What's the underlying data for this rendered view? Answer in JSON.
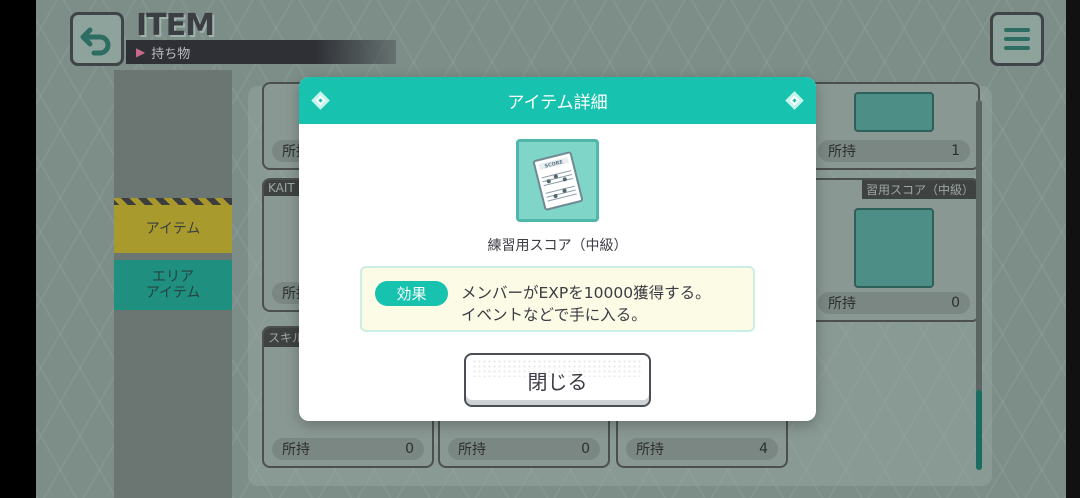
{
  "header": {
    "title": "ITEM",
    "subtitle": "持ち物"
  },
  "tabs": [
    {
      "label": "アイテム"
    },
    {
      "label": "エリア\nアイテム"
    }
  ],
  "grid": {
    "owned_label": "所持",
    "visible_cards": [
      {
        "name_fragment": "KAIT",
        "count": ""
      },
      {
        "name_fragment": "スキル",
        "count": ""
      },
      {
        "name_fragment": "",
        "count": "1"
      },
      {
        "name_fragment": "習用スコア（中級）",
        "count": "0"
      },
      {
        "name_fragment": "",
        "count": "0"
      },
      {
        "name_fragment": "",
        "count": "0"
      },
      {
        "name_fragment": "",
        "count": "4"
      }
    ]
  },
  "modal": {
    "title": "アイテム詳細",
    "item_name": "練習用スコア（中級）",
    "effect_label": "効果",
    "effect_lines": [
      "メンバーがEXPを10000獲得する。",
      "イベントなどで手に入る。"
    ],
    "close_label": "閉じる",
    "icon": "score-sheet-icon"
  },
  "colors": {
    "accent": "#17c2ae",
    "effect_bg": "#fbfbe6",
    "tab_items": "#a99a2d",
    "tab_area": "#1f8f80"
  }
}
